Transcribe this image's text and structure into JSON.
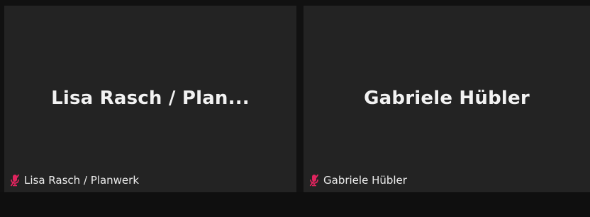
{
  "participants": [
    {
      "display_name": "Lisa Rasch / Plan...",
      "label": "Lisa Rasch / Planwerk",
      "mic_state": "muted",
      "icon": "mic-muted-icon"
    },
    {
      "display_name": "Gabriele Hübler",
      "label": "Gabriele Hübler",
      "mic_state": "muted",
      "icon": "mic-muted-icon"
    }
  ],
  "colors": {
    "tile_background": "#232323",
    "page_background": "#111111",
    "muted_icon": "#e0245e",
    "text": "#f2f2f2"
  }
}
